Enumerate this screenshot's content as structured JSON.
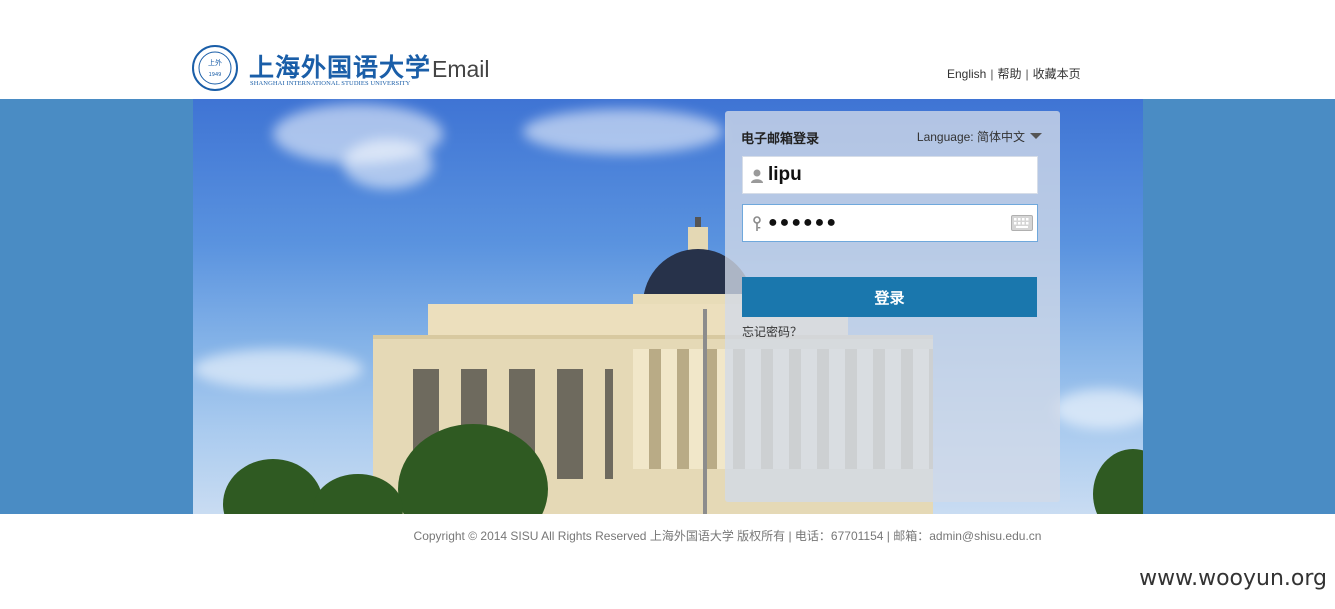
{
  "header": {
    "logo_cn": "上海外国语大学",
    "logo_en": "SHANGHAI INTERNATIONAL STUDIES UNIVERSITY",
    "logo_seal_text": "上外 1949",
    "product": "Email",
    "links": [
      "English",
      "帮助",
      "收藏本页"
    ]
  },
  "login": {
    "title": "电子邮箱登录",
    "language_label": "Language:",
    "language_value": "简体中文",
    "username_value": "lipu",
    "password_value": "●●●●●●",
    "submit_label": "登录",
    "forgot_label": "忘记密码？"
  },
  "footer": {
    "copyright": "Copyright © 2014 SISU All Rights Reserved 上海外国语大学 版权所有 | 电话：67701154 | 邮箱：admin@shisu.edu.cn"
  },
  "watermark": "www.wooyun.org",
  "colors": {
    "brand_blue": "#1a5ea8",
    "banner_bg": "#4a8cc4",
    "button_bg": "#1a77ad"
  },
  "icons": {
    "user": "user-icon",
    "key": "key-icon",
    "keyboard": "keyboard-icon",
    "caret": "caret-down-icon"
  }
}
